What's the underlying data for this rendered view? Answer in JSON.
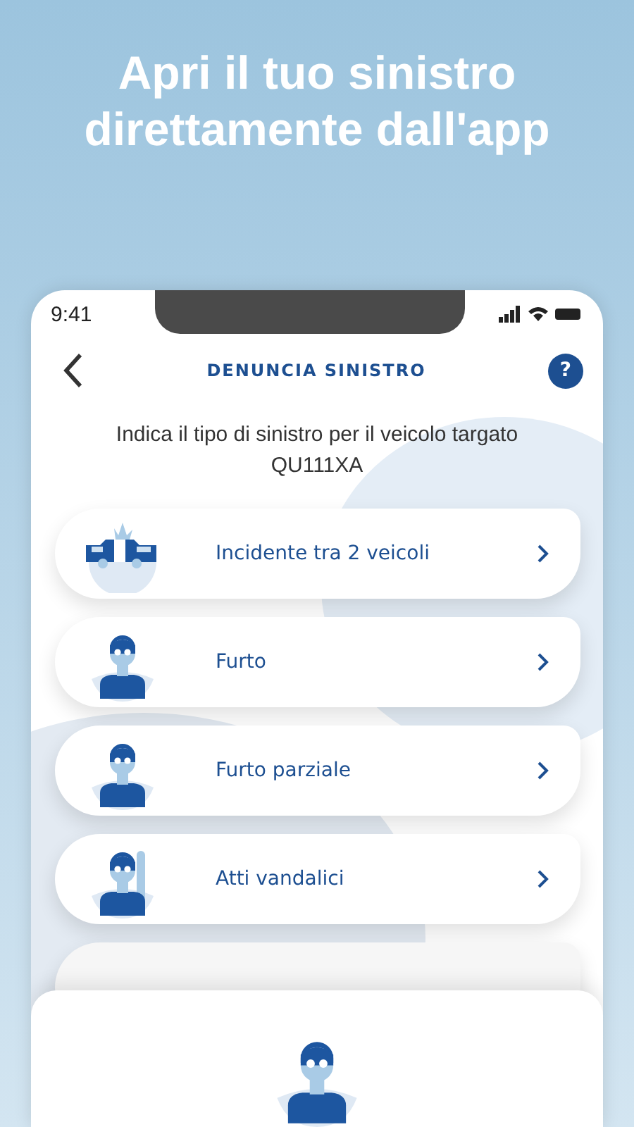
{
  "headline": "Apri il tuo sinistro direttamente dall'app",
  "status_bar": {
    "time": "9:41"
  },
  "header": {
    "title": "DENUNCIA SINISTRO",
    "help": "?"
  },
  "subtitle": "Indica il tipo di sinistro per il veicolo targato QU111XA",
  "options": [
    {
      "kind": "crash",
      "label": "Incidente tra 2 veicoli"
    },
    {
      "kind": "thief",
      "label": "Furto"
    },
    {
      "kind": "thief",
      "label": "Furto parziale"
    },
    {
      "kind": "vandal",
      "label": "Atti vandalici"
    }
  ],
  "bottom_sheet": {
    "kind": "thief"
  }
}
